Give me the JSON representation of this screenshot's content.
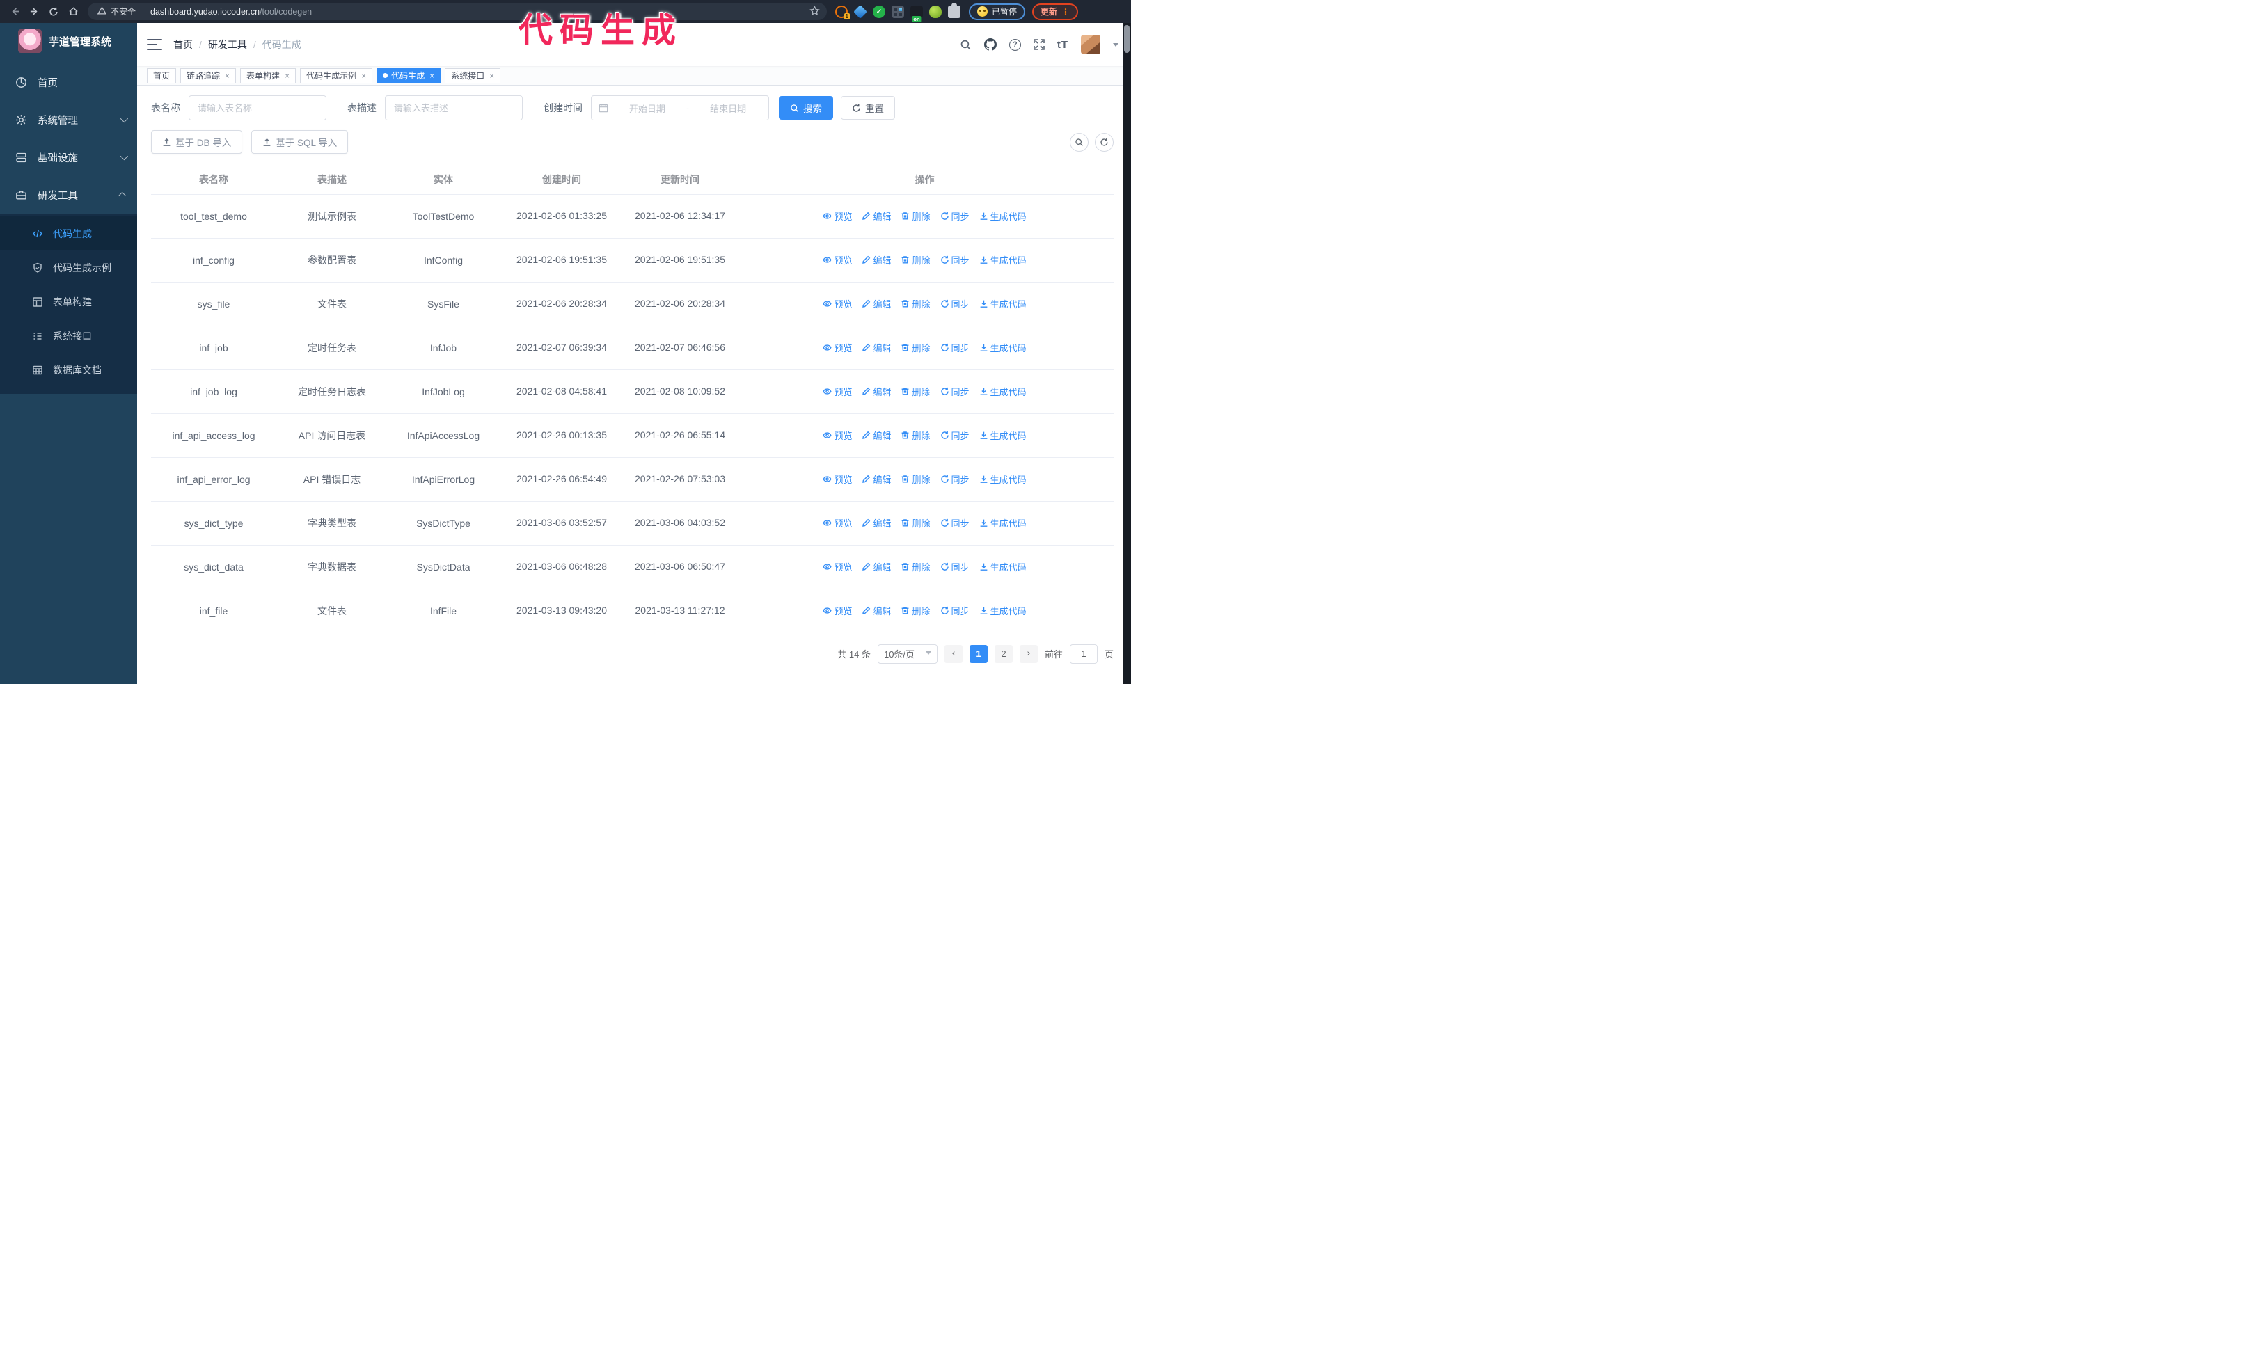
{
  "browser": {
    "security_label": "不安全",
    "url_host": "dashboard.yudao.iocoder.cn",
    "url_path": "/tool/codegen",
    "extension_badge_count": "1",
    "extension_badge_on": "on",
    "profile_badge": "已暂停",
    "update_label": "更新"
  },
  "overlay_title": "代码生成",
  "sidebar": {
    "logo_title": "芋道管理系统",
    "items": [
      {
        "label": "首页"
      },
      {
        "label": "系统管理"
      },
      {
        "label": "基础设施"
      },
      {
        "label": "研发工具"
      }
    ],
    "submenu": [
      {
        "label": "代码生成",
        "active": true
      },
      {
        "label": "代码生成示例"
      },
      {
        "label": "表单构建"
      },
      {
        "label": "系统接口"
      },
      {
        "label": "数据库文档"
      }
    ]
  },
  "header": {
    "breadcrumb": [
      "首页",
      "研发工具",
      "代码生成"
    ],
    "font_size_icon_text": "tT"
  },
  "tabs": [
    {
      "label": "首页",
      "closable": false,
      "active": false
    },
    {
      "label": "链路追踪",
      "closable": true,
      "active": false
    },
    {
      "label": "表单构建",
      "closable": true,
      "active": false
    },
    {
      "label": "代码生成示例",
      "closable": true,
      "active": false
    },
    {
      "label": "代码生成",
      "closable": true,
      "active": true
    },
    {
      "label": "系统接口",
      "closable": true,
      "active": false
    }
  ],
  "search": {
    "name_label": "表名称",
    "name_placeholder": "请输入表名称",
    "desc_label": "表描述",
    "desc_placeholder": "请输入表描述",
    "time_label": "创建时间",
    "start_placeholder": "开始日期",
    "range_separator": "-",
    "end_placeholder": "结束日期",
    "search_button": "搜索",
    "reset_button": "重置"
  },
  "toolbar": {
    "import_db_label": "基于 DB 导入",
    "import_sql_label": "基于 SQL 导入"
  },
  "table": {
    "columns": [
      "表名称",
      "表描述",
      "实体",
      "创建时间",
      "更新时间",
      "操作"
    ],
    "actions": [
      "预览",
      "编辑",
      "删除",
      "同步",
      "生成代码"
    ],
    "rows": [
      {
        "name": "tool_test_demo",
        "desc": "测试示例表",
        "entity": "ToolTestDemo",
        "created": "2021-02-06 01:33:25",
        "updated": "2021-02-06 12:34:17"
      },
      {
        "name": "inf_config",
        "desc": "参数配置表",
        "entity": "InfConfig",
        "created": "2021-02-06 19:51:35",
        "updated": "2021-02-06 19:51:35"
      },
      {
        "name": "sys_file",
        "desc": "文件表",
        "entity": "SysFile",
        "created": "2021-02-06 20:28:34",
        "updated": "2021-02-06 20:28:34"
      },
      {
        "name": "inf_job",
        "desc": "定时任务表",
        "entity": "InfJob",
        "created": "2021-02-07 06:39:34",
        "updated": "2021-02-07 06:46:56"
      },
      {
        "name": "inf_job_log",
        "desc": "定时任务日志表",
        "entity": "InfJobLog",
        "created": "2021-02-08 04:58:41",
        "updated": "2021-02-08 10:09:52"
      },
      {
        "name": "inf_api_access_log",
        "desc": "API 访问日志表",
        "entity": "InfApiAccessLog",
        "created": "2021-02-26 00:13:35",
        "updated": "2021-02-26 06:55:14"
      },
      {
        "name": "inf_api_error_log",
        "desc": "API 错误日志",
        "entity": "InfApiErrorLog",
        "created": "2021-02-26 06:54:49",
        "updated": "2021-02-26 07:53:03"
      },
      {
        "name": "sys_dict_type",
        "desc": "字典类型表",
        "entity": "SysDictType",
        "created": "2021-03-06 03:52:57",
        "updated": "2021-03-06 04:03:52"
      },
      {
        "name": "sys_dict_data",
        "desc": "字典数据表",
        "entity": "SysDictData",
        "created": "2021-03-06 06:48:28",
        "updated": "2021-03-06 06:50:47"
      },
      {
        "name": "inf_file",
        "desc": "文件表",
        "entity": "InfFile",
        "created": "2021-03-13 09:43:20",
        "updated": "2021-03-13 11:27:12"
      }
    ]
  },
  "pagination": {
    "total": "共 14 条",
    "page_size": "10条/页",
    "pages": [
      "1",
      "2"
    ],
    "active_page": "1",
    "prev": "‹",
    "next": "›",
    "goto_label": "前往",
    "goto_value": "1",
    "page_suffix": "页"
  },
  "colors": {
    "accent": "#338df7",
    "annotation": "#f1275b",
    "sidebar": "#20435c",
    "submenu": "#152e46"
  }
}
